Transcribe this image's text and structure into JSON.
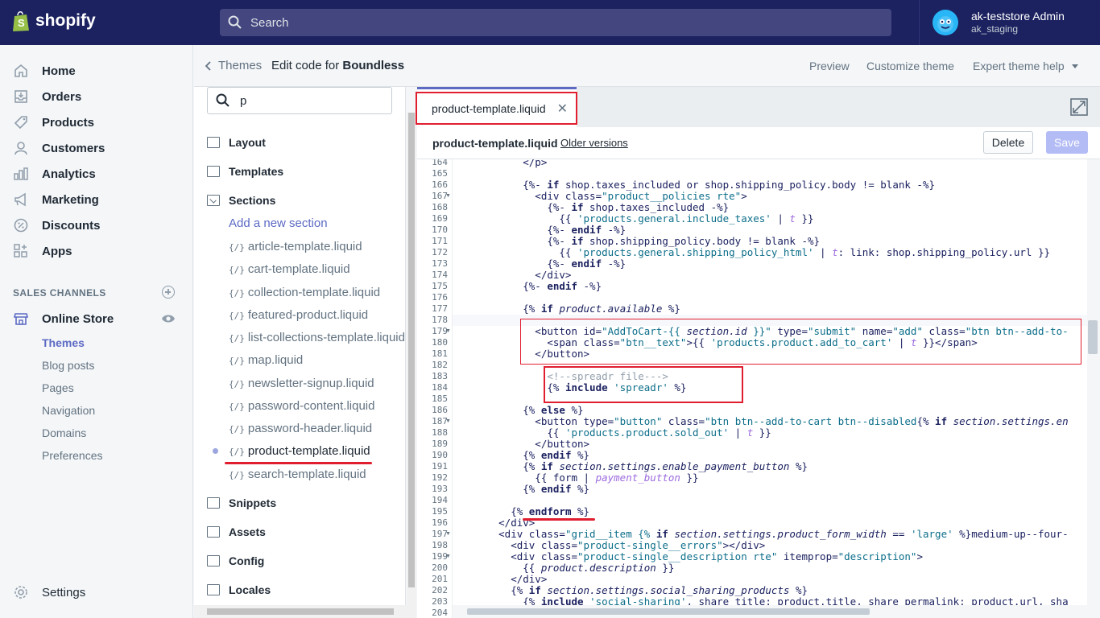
{
  "brand": {
    "name": "shopify"
  },
  "search": {
    "placeholder": "Search"
  },
  "account": {
    "name": "ak-teststore Admin",
    "store": "ak_staging"
  },
  "nav": {
    "items": [
      {
        "label": "Home",
        "icon": "home-icon"
      },
      {
        "label": "Orders",
        "icon": "orders-icon"
      },
      {
        "label": "Products",
        "icon": "tag-icon"
      },
      {
        "label": "Customers",
        "icon": "person-icon"
      },
      {
        "label": "Analytics",
        "icon": "bar-chart-icon"
      },
      {
        "label": "Marketing",
        "icon": "target-icon"
      },
      {
        "label": "Discounts",
        "icon": "discount-icon"
      },
      {
        "label": "Apps",
        "icon": "apps-icon"
      }
    ],
    "sales_channels": "SALES CHANNELS",
    "online_store": "Online Store",
    "sub_items": [
      "Themes",
      "Blog posts",
      "Pages",
      "Navigation",
      "Domains",
      "Preferences"
    ],
    "settings": "Settings"
  },
  "header": {
    "back": "Themes",
    "edit_prefix": "Edit code for",
    "theme_name": "Boundless",
    "preview": "Preview",
    "customize": "Customize theme",
    "expert_help": "Expert theme help"
  },
  "files": {
    "search_value": "p",
    "folders": [
      "Layout",
      "Templates",
      "Sections",
      "Snippets",
      "Assets",
      "Config",
      "Locales"
    ],
    "add_section": "Add a new section",
    "liquid_icon": "{/}",
    "sections": [
      "article-template.liquid",
      "cart-template.liquid",
      "collection-template.liquid",
      "featured-product.liquid",
      "list-collections-template.liquid",
      "map.liquid",
      "newsletter-signup.liquid",
      "password-content.liquid",
      "password-header.liquid",
      "product-template.liquid",
      "search-template.liquid"
    ]
  },
  "editor": {
    "tab_name": "product-template.liquid",
    "file_name": "product-template.liquid",
    "older_versions": "Older versions",
    "delete": "Delete",
    "save": "Save",
    "line_numbers": [
      "164",
      "165",
      "166",
      "167",
      "168",
      "169",
      "170",
      "171",
      "172",
      "173",
      "174",
      "175",
      "176",
      "177",
      "178",
      "179",
      "180",
      "181",
      "182",
      "183",
      "184",
      "185",
      "186",
      "187",
      "188",
      "189",
      "190",
      "191",
      "192",
      "193",
      "194",
      "195",
      "196",
      "197",
      "198",
      "199",
      "200",
      "201",
      "202",
      "203",
      "204"
    ]
  },
  "colors": {
    "topbar": "#1c2260",
    "accent": "#5c6ac4",
    "highlight": "#e01e2f"
  }
}
